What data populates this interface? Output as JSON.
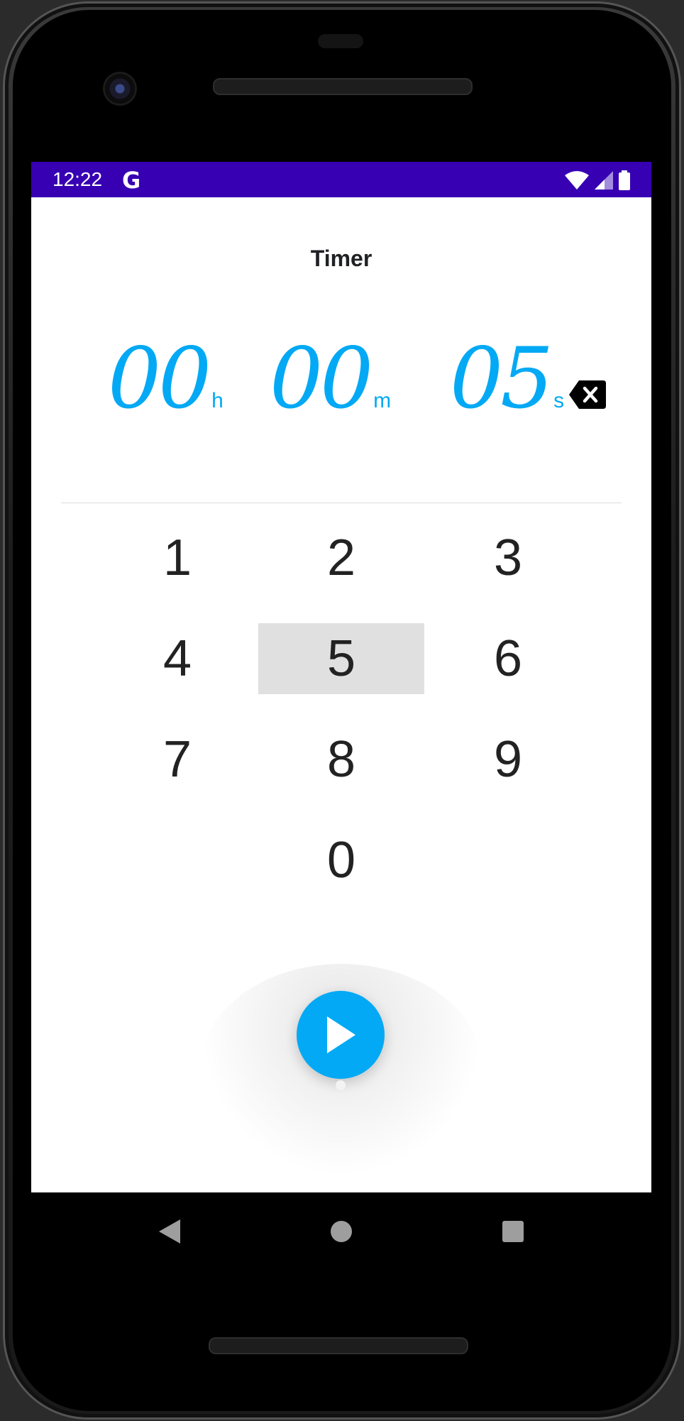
{
  "status_bar": {
    "time": "12:22",
    "g_icon_label": "G",
    "icons": [
      "wifi-icon",
      "signal-icon",
      "battery-icon"
    ],
    "background": "#3700b3"
  },
  "header": {
    "title": "Timer"
  },
  "timer_display": {
    "hours": "00",
    "hours_unit": "h",
    "minutes": "00",
    "minutes_unit": "m",
    "seconds": "05",
    "seconds_unit": "s",
    "accent_color": "#03a9f4"
  },
  "keypad": {
    "keys": [
      "1",
      "2",
      "3",
      "4",
      "5",
      "6",
      "7",
      "8",
      "9",
      "0"
    ],
    "pressed_key": "5"
  },
  "fab": {
    "icon": "play-icon",
    "color": "#03a9f4"
  },
  "nav_bar": {
    "buttons": [
      "back-icon",
      "home-icon",
      "recents-icon"
    ]
  }
}
